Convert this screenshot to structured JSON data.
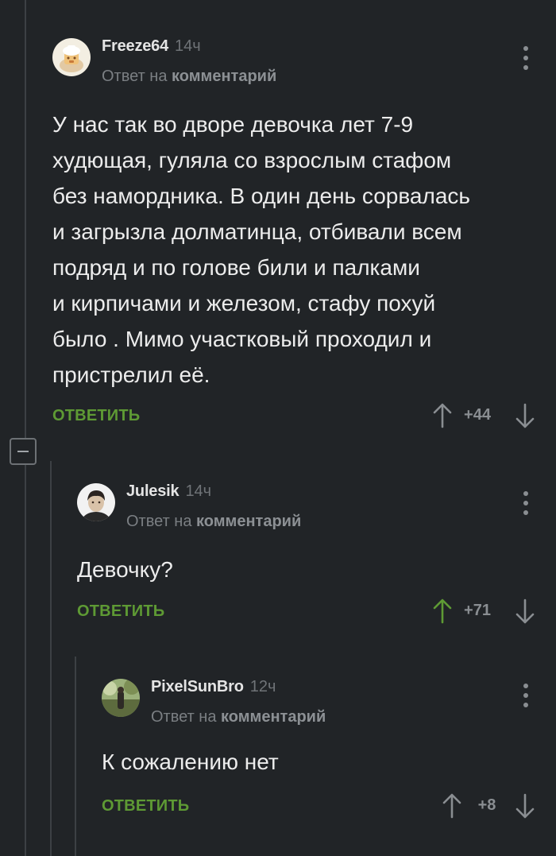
{
  "comments": [
    {
      "author": "Freeze64",
      "time": "14ч",
      "reply_prefix": "Ответ на",
      "reply_link": "комментарий",
      "text": "У нас так во дворе девочка лет 7-9\nхудющая, гуляла со взрослым стафом\nбез намордника. В один день сорвалась\nи загрызла долматинца, отбивали всем\nподряд и по голове били и палками\nи кирпичами и железом, стафу похуй\nбыло . Мимо участковый проходил и\nпристрелил её.",
      "reply_label": "ОТВЕТИТЬ",
      "score": "+44",
      "upvoted": false
    },
    {
      "author": "Julesik",
      "time": "14ч",
      "reply_prefix": "Ответ на",
      "reply_link": "комментарий",
      "text": "Девочку?",
      "reply_label": "ОТВЕТИТЬ",
      "score": "+71",
      "upvoted": true
    },
    {
      "author": "PixelSunBro",
      "time": "12ч",
      "reply_prefix": "Ответ на",
      "reply_link": "комментарий",
      "text": "К сожалению нет",
      "reply_label": "ОТВЕТИТЬ",
      "score": "+8",
      "upvoted": false
    }
  ],
  "icons": {
    "more": "vertical-dots-icon",
    "upvote": "arrow-up-icon",
    "downvote": "arrow-down-icon",
    "collapse": "minus-icon"
  },
  "colors": {
    "background": "#212427",
    "accent_green": "#5e9a34",
    "upvoted_arrow": "#5e9a34",
    "muted_text": "#7b7f83"
  }
}
